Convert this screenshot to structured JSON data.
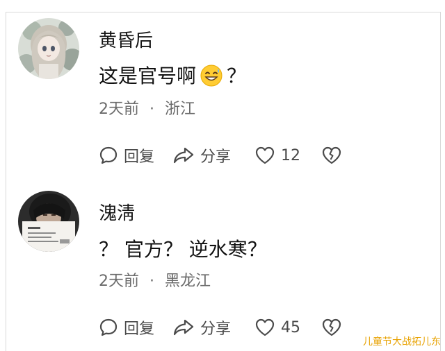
{
  "comments": [
    {
      "username": "黄昏后",
      "content_text": "这是官号啊",
      "emoji": "grinning-sweat-emoji",
      "content_suffix": "？",
      "time": "2天前",
      "separator": "·",
      "location": "浙江",
      "reply_label": "回复",
      "share_label": "分享",
      "like_count": "12"
    },
    {
      "username": "溾淸",
      "content_text": "？ 官方？ 逆水寒？",
      "time": "2天前",
      "separator": "·",
      "location": "黑龙江",
      "reply_label": "回复",
      "share_label": "分享",
      "like_count": "45"
    }
  ],
  "watermark": "儿童节大战拓儿东",
  "colors": {
    "text": "#111111",
    "meta": "#6b6b6b",
    "icon": "#4a4a4a",
    "watermark": "#e8a200",
    "border": "#d9d9d9"
  }
}
